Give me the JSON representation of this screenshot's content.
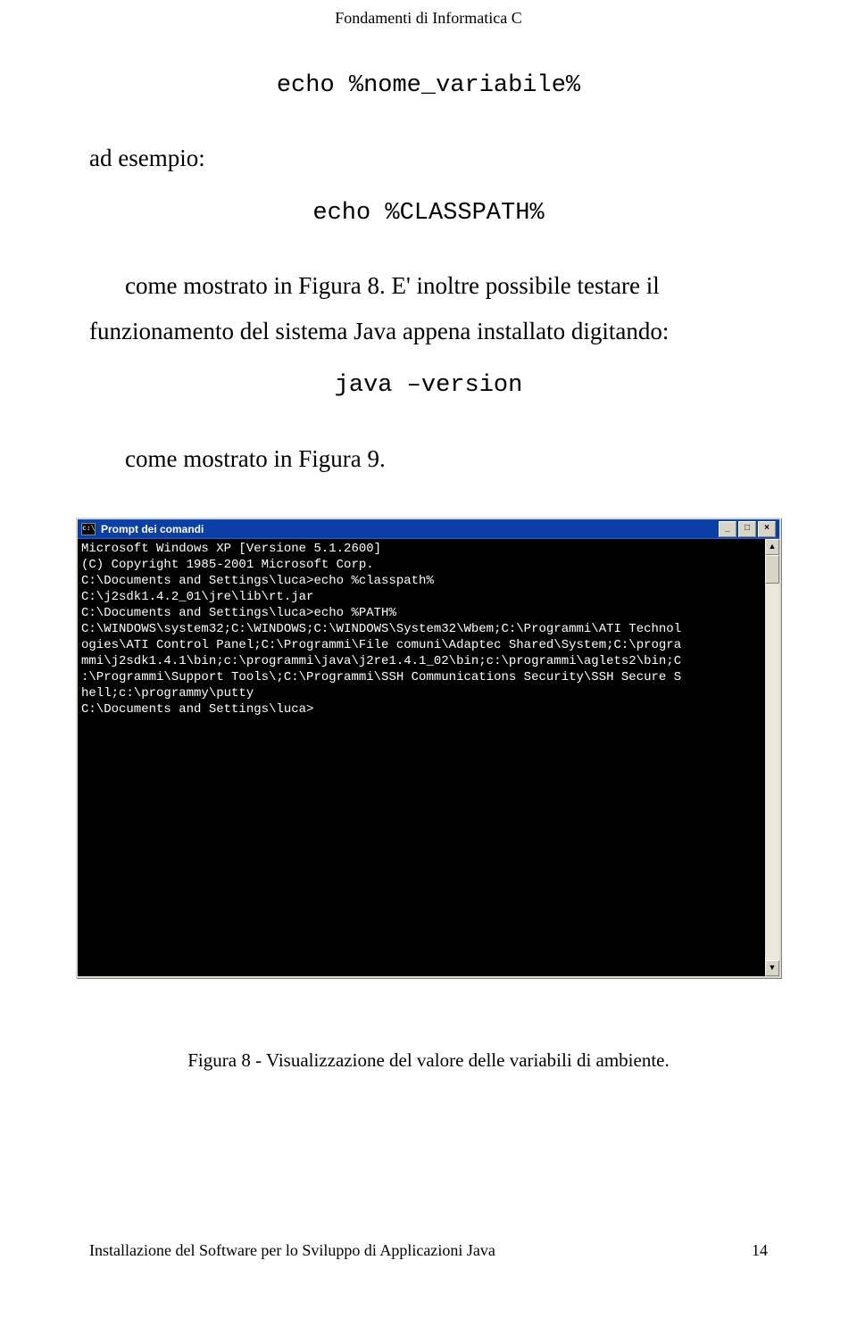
{
  "header": "Fondamenti di Informatica C",
  "text": {
    "ad_esempio": "ad esempio:",
    "code1": "echo %nome_variabile%",
    "code2": "echo %CLASSPATH%",
    "para1": "come mostrato in Figura 8. E' inoltre possibile testare il",
    "para2": "funzionamento del sistema Java appena installato digitando:",
    "code3": "java –version",
    "para3": "come mostrato in Figura 9."
  },
  "cmd": {
    "title": "Prompt dei comandi",
    "icon_label": "c:\\",
    "buttons": {
      "min": "_",
      "max": "□",
      "close": "×"
    },
    "scroll": {
      "up": "▲",
      "down": "▼"
    },
    "lines": [
      "Microsoft Windows XP [Versione 5.1.2600]",
      "(C) Copyright 1985-2001 Microsoft Corp.",
      "",
      "C:\\Documents and Settings\\luca>echo %classpath%",
      "C:\\j2sdk1.4.2_01\\jre\\lib\\rt.jar",
      "",
      "C:\\Documents and Settings\\luca>echo %PATH%",
      "C:\\WINDOWS\\system32;C:\\WINDOWS;C:\\WINDOWS\\System32\\Wbem;C:\\Programmi\\ATI Technol",
      "ogies\\ATI Control Panel;C:\\Programmi\\File comuni\\Adaptec Shared\\System;C:\\progra",
      "mmi\\j2sdk1.4.1\\bin;c:\\programmi\\java\\j2re1.4.1_02\\bin;c:\\programmi\\aglets2\\bin;C",
      ":\\Programmi\\Support Tools\\;C:\\Programmi\\SSH Communications Security\\SSH Secure S",
      "hell;c:\\programmy\\putty",
      "",
      "C:\\Documents and Settings\\luca>"
    ]
  },
  "caption": "Figura 8 - Visualizzazione del valore delle variabili di ambiente.",
  "footer": {
    "left": "Installazione del Software per lo Sviluppo di Applicazioni Java",
    "right": "14"
  }
}
